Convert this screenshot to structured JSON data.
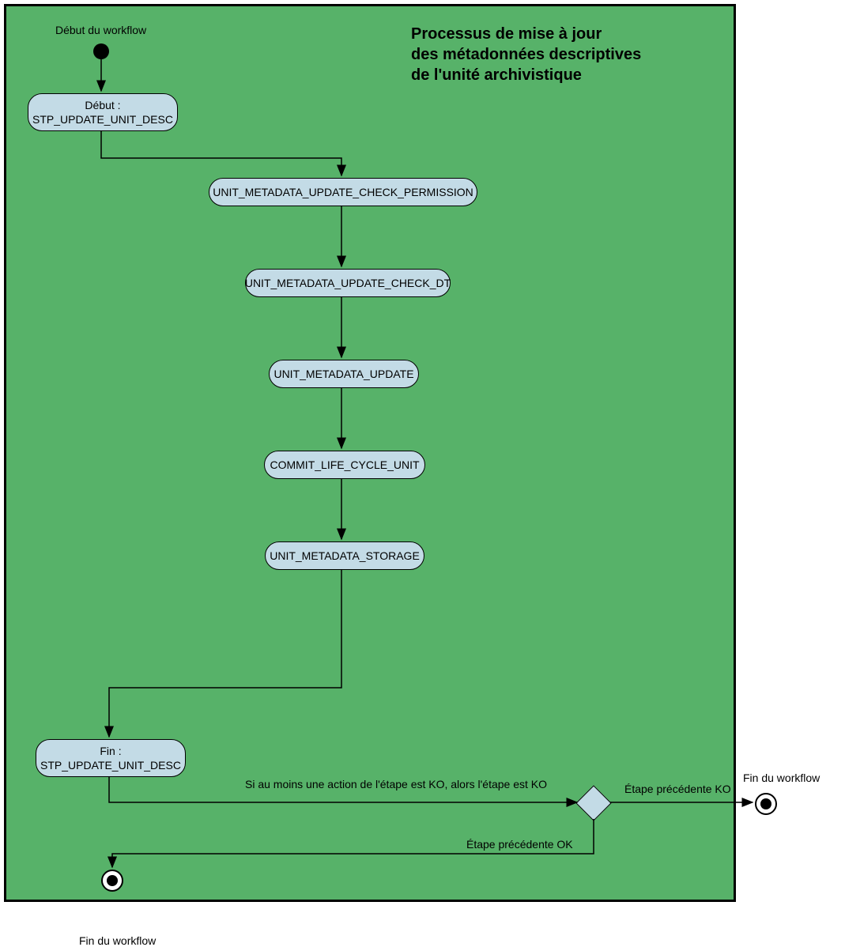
{
  "title_line1": "Processus de mise à jour",
  "title_line2": "des métadonnées descriptives",
  "title_line3": "de l'unité archivistique",
  "labels": {
    "debut_workflow": "Début du workflow",
    "fin_workflow_bottom": "Fin du workflow",
    "fin_workflow_right": "Fin du workflow",
    "condition_ko": "Si au moins une action de l'étape est KO, alors l'étape est KO",
    "etape_ko": "Étape précédente KO",
    "etape_ok": "Étape précédente OK"
  },
  "nodes": {
    "debut": {
      "line1": "Début :",
      "line2": "STP_UPDATE_UNIT_DESC"
    },
    "check_permission": "UNIT_METADATA_UPDATE_CHECK_PERMISSION",
    "check_dt": "UNIT_METADATA_UPDATE_CHECK_DT",
    "update": "UNIT_METADATA_UPDATE",
    "commit": "COMMIT_LIFE_CYCLE_UNIT",
    "storage": "UNIT_METADATA_STORAGE",
    "fin": {
      "line1": "Fin :",
      "line2": "STP_UPDATE_UNIT_DESC"
    }
  }
}
